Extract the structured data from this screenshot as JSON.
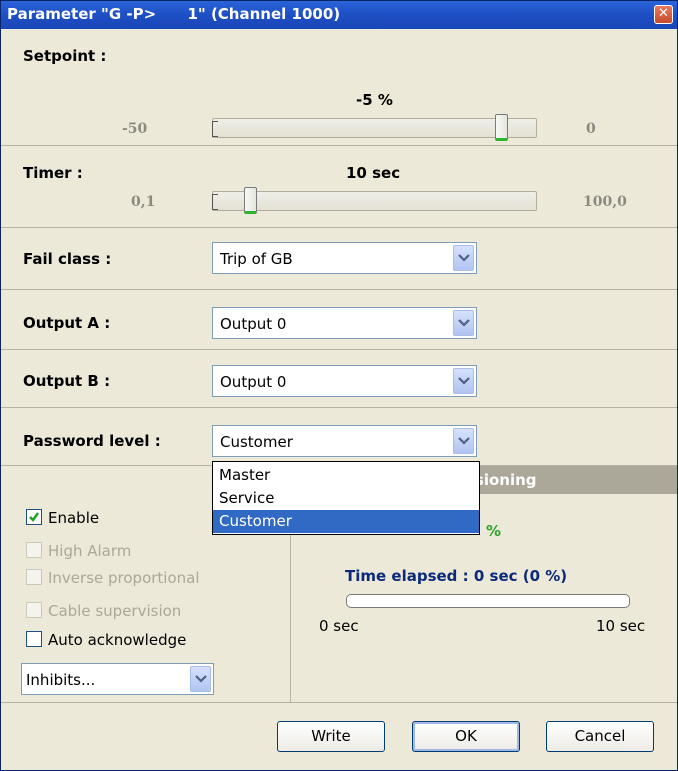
{
  "window": {
    "title": "Parameter \"G -P>      1\" (Channel 1000)",
    "close_glyph": "✕"
  },
  "setpoint": {
    "label": "Setpoint :",
    "value_text": "-5 %",
    "min_text": "-50",
    "max_text": "0",
    "value": -5,
    "min": -50,
    "max": 0
  },
  "timer": {
    "label": "Timer :",
    "value_text": "10 sec",
    "min_text": "0,1",
    "max_text": "100,0",
    "value": 10,
    "min": 0.1,
    "max": 100
  },
  "fail_class": {
    "label": "Fail class :",
    "value": "Trip of GB"
  },
  "output_a": {
    "label": "Output A :",
    "value": "Output 0"
  },
  "output_b": {
    "label": "Output B :",
    "value": "Output 0"
  },
  "password_level": {
    "label": "Password level :",
    "value": "Customer",
    "options": [
      "Master",
      "Service",
      "Customer"
    ],
    "selected_index": 2
  },
  "checkboxes": [
    {
      "label": "Enable",
      "checked": true,
      "enabled": true
    },
    {
      "label": "High Alarm",
      "checked": false,
      "enabled": false
    },
    {
      "label": "Inverse proportional",
      "checked": false,
      "enabled": false
    },
    {
      "label": "Cable supervision",
      "checked": false,
      "enabled": false
    },
    {
      "label": "Auto acknowledge",
      "checked": false,
      "enabled": true
    }
  ],
  "inhibits": {
    "value": "Inhibits..."
  },
  "commissioning": {
    "header_visible": "ssioning",
    "actual_value_visible": "%",
    "time_elapsed": "Time elapsed : 0 sec (0 %)",
    "progress": 0,
    "start_label": "0 sec",
    "end_label": "10 sec"
  },
  "buttons": {
    "write": "Write",
    "ok": "OK",
    "cancel": "Cancel"
  },
  "colors": {
    "title_bar": "#1e4fc4",
    "selection": "#316ac5",
    "elapsed_text": "#0b2a7a",
    "actual_value": "#2aa52a"
  }
}
